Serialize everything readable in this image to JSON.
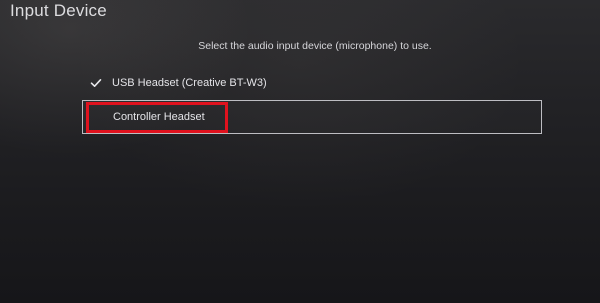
{
  "page": {
    "title": "Input Device",
    "instruction": "Select the audio input device (microphone) to use."
  },
  "options": [
    {
      "label": "USB Headset (Creative BT-W3)",
      "checked": true,
      "icon": "checkmark-icon"
    },
    {
      "label": "Controller Headset",
      "checked": false,
      "focused": true
    }
  ],
  "colors": {
    "highlight": "#e0121e",
    "focus_border": "#bdbdc2",
    "background": "#1e1e21"
  }
}
